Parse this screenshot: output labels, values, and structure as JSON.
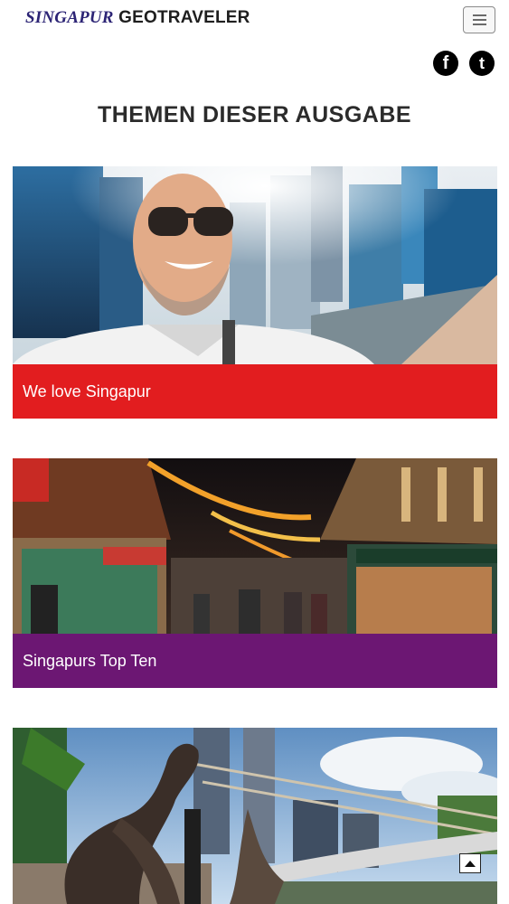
{
  "header": {
    "brand_part1": "SINGAPUR",
    "brand_part2": "GEOTRAVELER",
    "brand_color": "#2c2475"
  },
  "social": [
    {
      "name": "facebook-icon",
      "glyph": "f"
    },
    {
      "name": "twitter-icon",
      "glyph": "t"
    }
  ],
  "main": {
    "section_title": "THEMEN DIESER AUSGABE",
    "cards": [
      {
        "caption": "We love Singapur",
        "color": "#e21d1f",
        "image": "selfie-man-skyline"
      },
      {
        "caption": "Singapurs Top Ten",
        "color": "#6c1773",
        "image": "chinatown-market-night"
      },
      {
        "caption": "",
        "color": "",
        "image": "river-sculptures-bridge"
      }
    ]
  }
}
